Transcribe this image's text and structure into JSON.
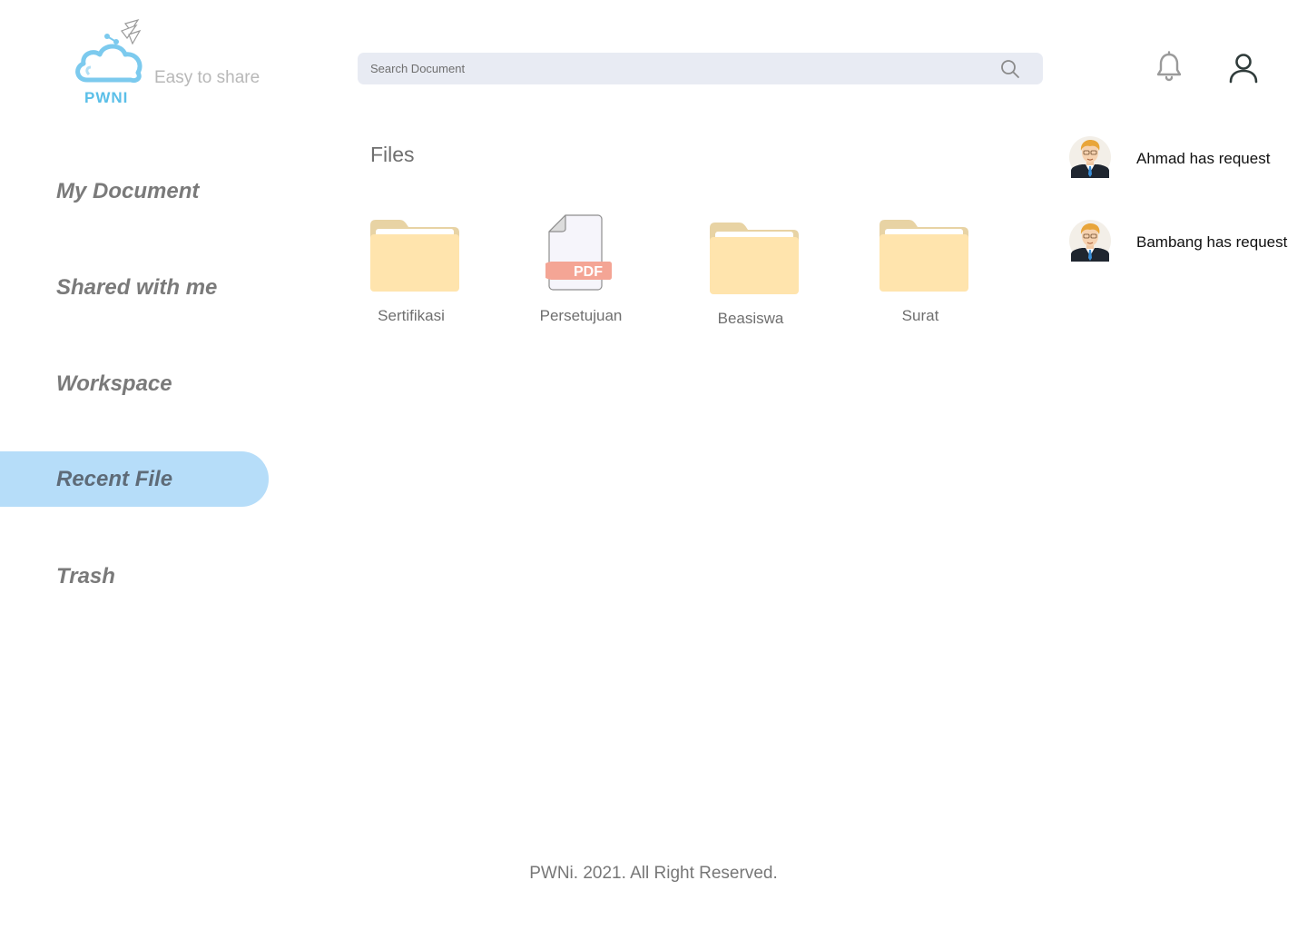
{
  "brand": {
    "logo_text": "PWNI",
    "tagline": "Easy to share"
  },
  "header": {
    "search": {
      "placeholder": "Search Document",
      "value": ""
    },
    "icons": [
      "search-icon",
      "bell-icon",
      "user-icon"
    ]
  },
  "sidebar": {
    "items": [
      {
        "label": "My Document",
        "active": false
      },
      {
        "label": "Shared with me",
        "active": false
      },
      {
        "label": "Workspace",
        "active": false
      },
      {
        "label": "Recent File",
        "active": true
      },
      {
        "label": "Trash",
        "active": false
      }
    ]
  },
  "main": {
    "heading": "Files",
    "files": [
      {
        "name": "Sertifikasi",
        "type": "folder"
      },
      {
        "name": "Persetujuan",
        "type": "pdf",
        "badge": "PDF"
      },
      {
        "name": "Beasiswa",
        "type": "folder"
      },
      {
        "name": "Surat",
        "type": "folder"
      }
    ]
  },
  "notifications": [
    {
      "text": "Ahmad has request",
      "avatar": "avatar-man-icon"
    },
    {
      "text": "Bambang has request",
      "avatar": "avatar-man-icon"
    }
  ],
  "footer": {
    "text": "PWNi. 2021. All Right Reserved."
  },
  "colors": {
    "accent": "#b6ddf9",
    "brand": "#5bbfe8",
    "folder": "#ffe4ad",
    "folder_tab": "#e8d3a4",
    "pdf_badge": "#f4a595",
    "search_bg": "#e8ebf3"
  }
}
